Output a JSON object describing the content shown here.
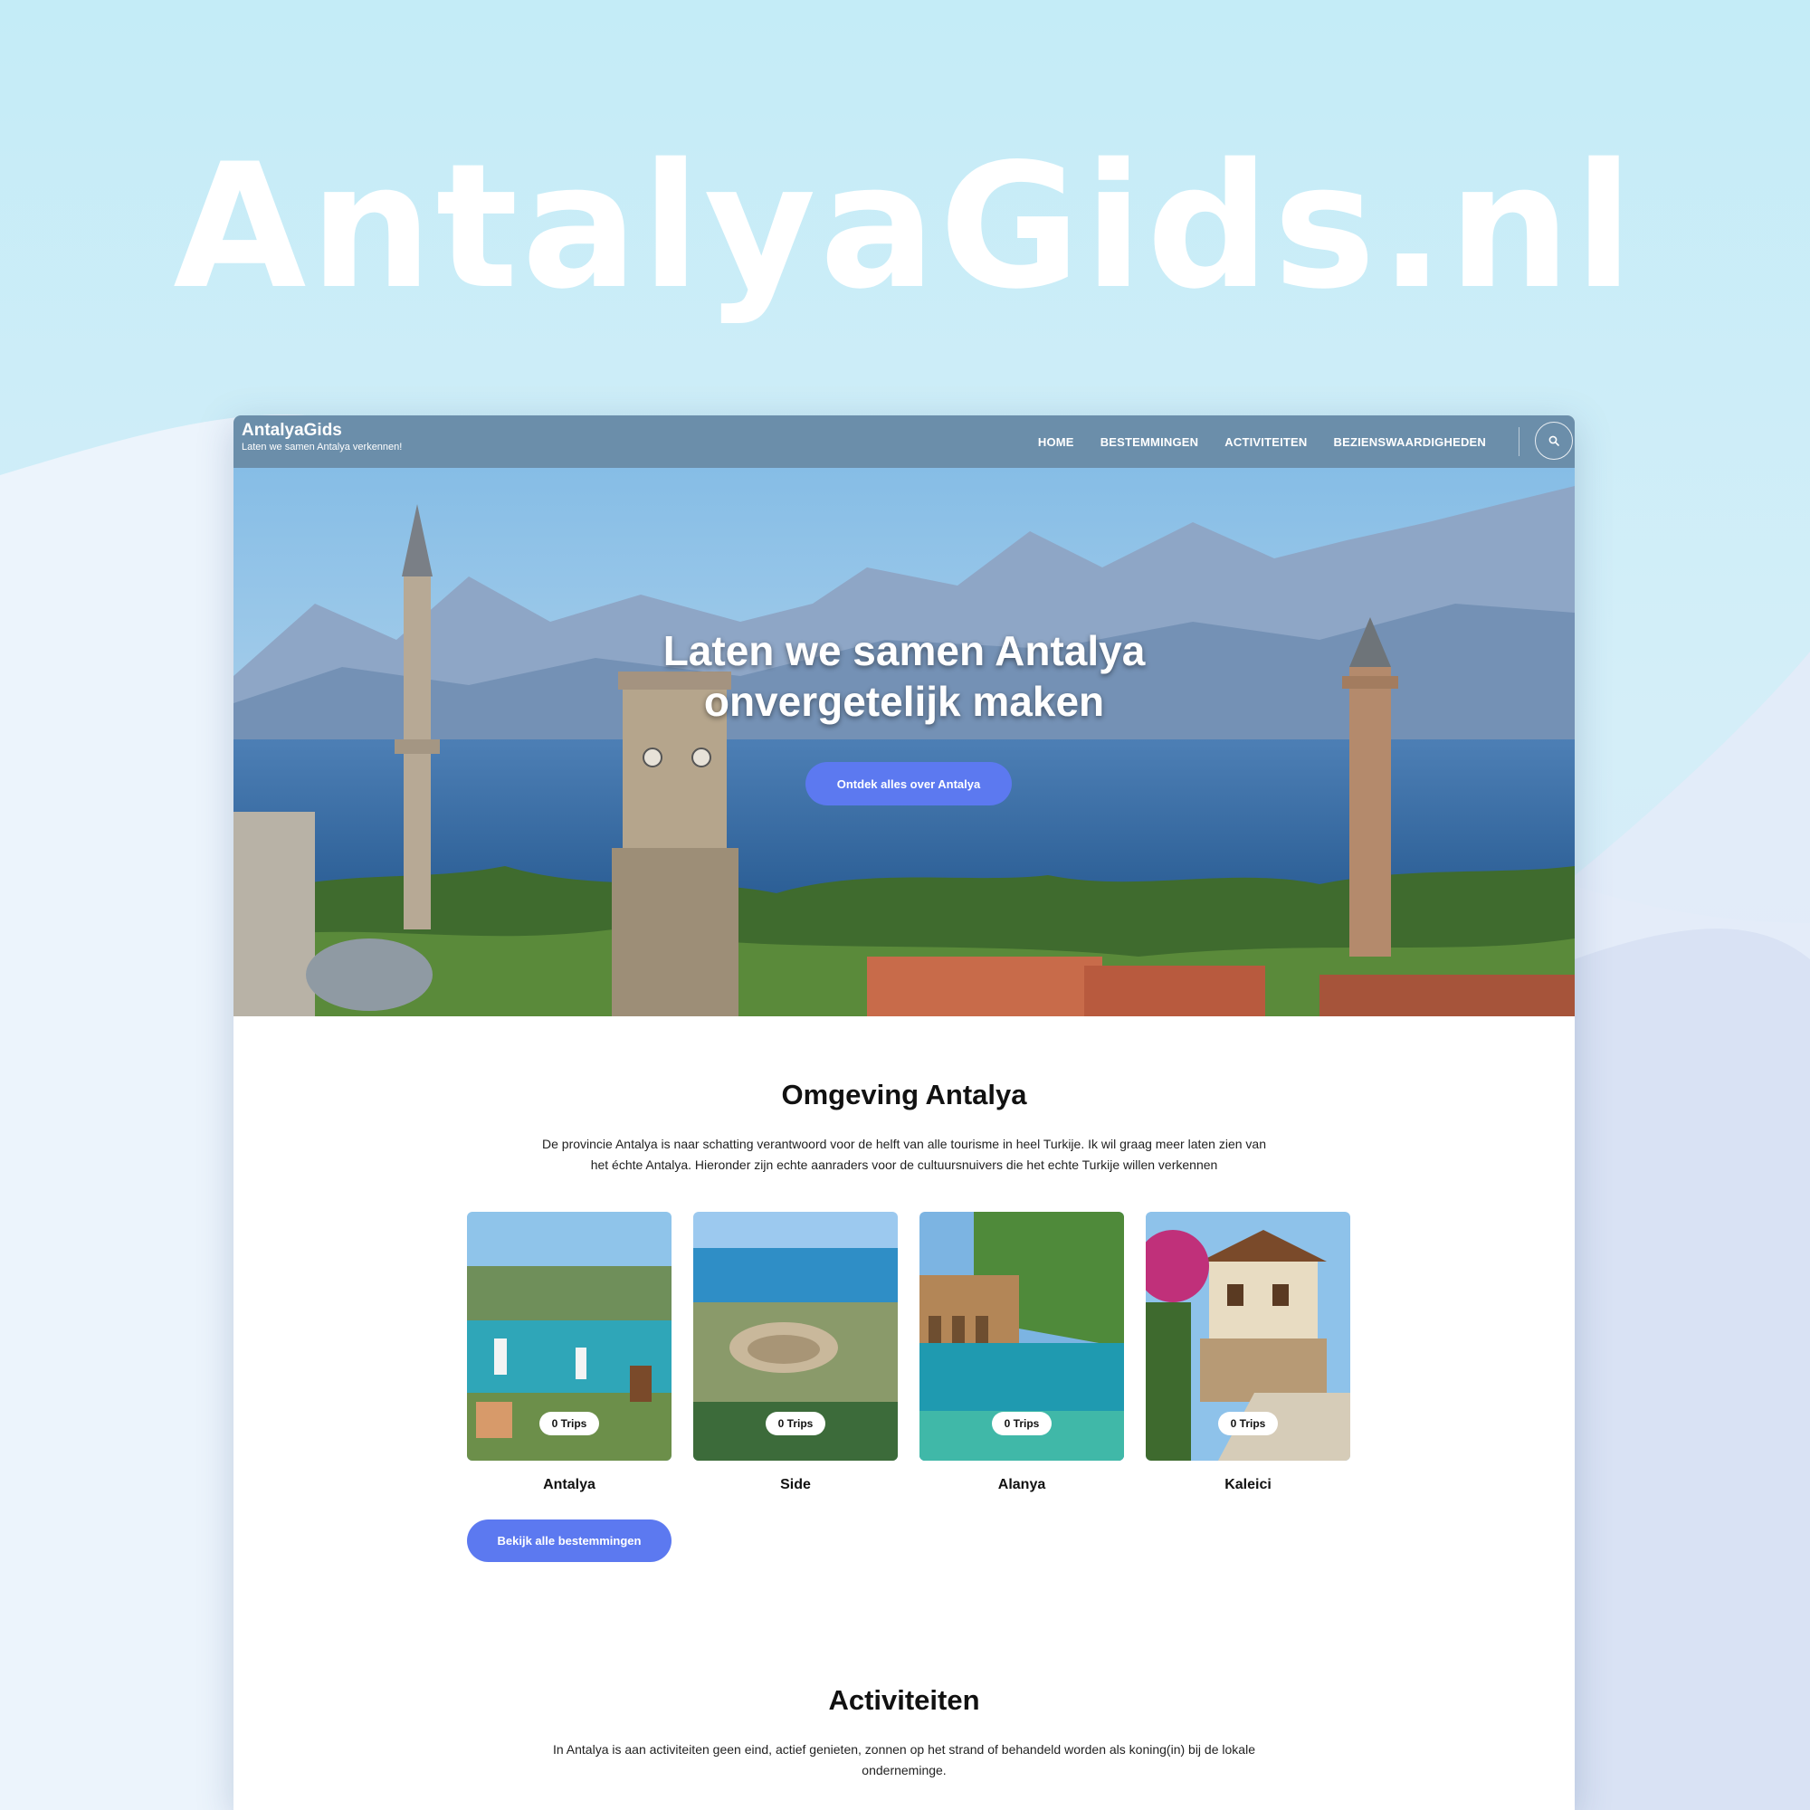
{
  "banner": {
    "title": "AntalyaGids.nl"
  },
  "navbar": {
    "brand": "AntalyaGids",
    "tagline": "Laten we samen Antalya verkennen!",
    "items": [
      "HOME",
      "BESTEMMINGEN",
      "ACTIVITEITEN",
      "BEZIENSWAARDIGHEDEN"
    ],
    "search_icon": "search-icon"
  },
  "hero": {
    "title_line1": "Laten we samen Antalya",
    "title_line2": "onvergetelijk maken",
    "button": "Ontdek alles over Antalya"
  },
  "omgeving": {
    "title": "Omgeving Antalya",
    "description": "De provincie Antalya is naar schatting verantwoord voor de helft van alle tourisme in heel Turkije. Ik wil graag meer laten zien van het échte Antalya. Hieronder zijn echte aanraders voor de cultuursnuivers die het echte Turkije willen verkennen",
    "destinations": [
      {
        "name": "Antalya",
        "trips": "0 Trips"
      },
      {
        "name": "Side",
        "trips": "0 Trips"
      },
      {
        "name": "Alanya",
        "trips": "0 Trips"
      },
      {
        "name": "Kaleici",
        "trips": "0 Trips"
      }
    ],
    "button": "Bekijk alle bestemmingen"
  },
  "activiteiten": {
    "title": "Activiteiten",
    "description": "In Antalya is aan activiteiten geen eind, actief genieten, zonnen op het strand of behandeld worden als koning(in) bij de lokale onderneminge."
  },
  "colors": {
    "accent": "#5c79f0",
    "navbar": "#6b8eaa",
    "background": "#c4ecf7"
  }
}
